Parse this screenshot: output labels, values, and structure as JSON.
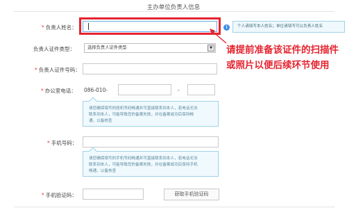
{
  "page": {
    "title": "主办单位负责人信息"
  },
  "fields": {
    "name": {
      "label": "负责人姓名：",
      "required": true,
      "value": ""
    },
    "name_tip": "个人请填写本人姓名；单位请填写可以负责人姓名",
    "id_type": {
      "label": "负责人证件类型：",
      "selected": "选择负责人证件类型"
    },
    "id_number": {
      "label": "负责人证件号码：",
      "required": true
    },
    "office_phone": {
      "label": "办公室电话：",
      "required": true,
      "prefix": "086-010-",
      "separator": "-",
      "hint_lines": [
        "请您确保填写的座机号码畅通并可直接联系到本人，若电话无法",
        "联系到本人，可能导致您的备案失败，并在备案成功后保持畅",
        "通，以备核查"
      ]
    },
    "mobile": {
      "label": "手机号码：",
      "required": true,
      "hint_lines": [
        "请您确保填写的手机号码畅通并可直接联系到本人，若电话无法",
        "联系到本人，可能导致您的备案失败，并在备案成功后保持手机",
        "畅通，以备核查"
      ]
    },
    "sms_code": {
      "label": "手机验证码：",
      "required": true,
      "button_label": "获取手机验证码"
    }
  },
  "annotation": {
    "lines": [
      "请提前准备该证件的扫描件",
      "或照片以便后续环节使用"
    ],
    "color": "#e5242f"
  },
  "icons": {
    "info": "info-icon",
    "select_arrow": "chevron-down-icon"
  }
}
